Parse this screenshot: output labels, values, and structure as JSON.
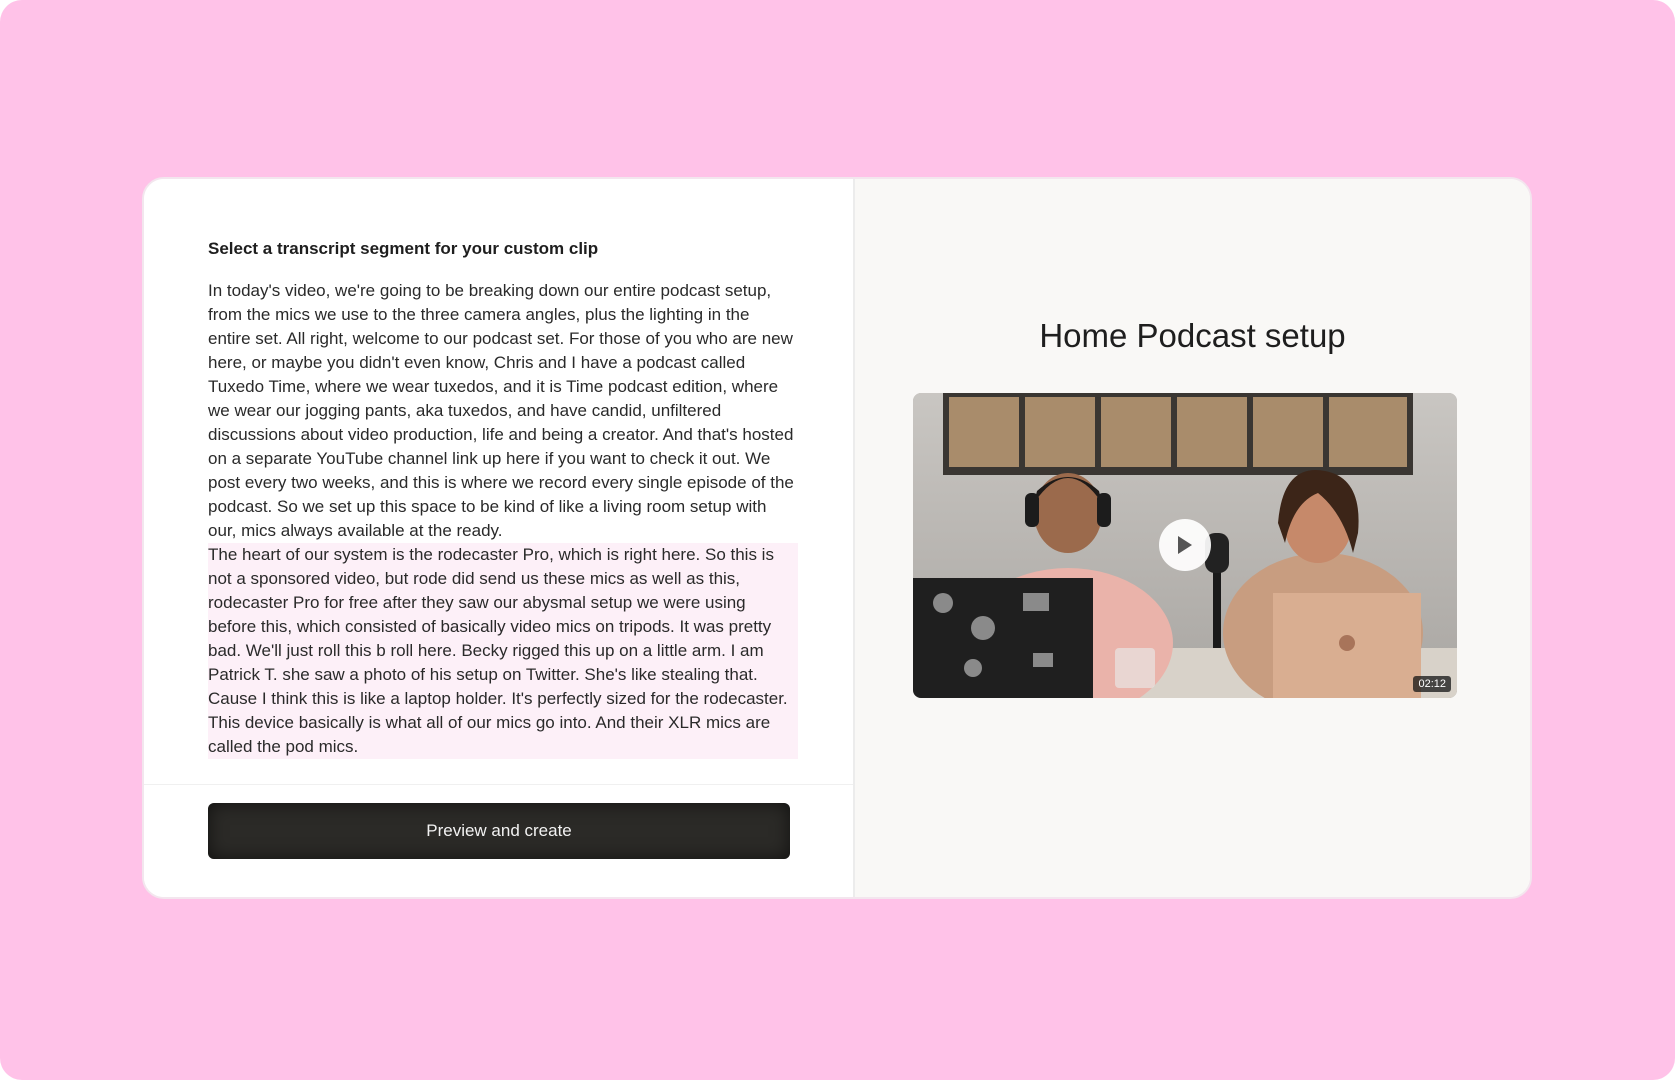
{
  "transcript_panel": {
    "heading": "Select a transcript segment for your custom clip",
    "segments": [
      {
        "text": "In today's video, we're going to be breaking down our entire podcast setup, from the mics we use to the three camera angles, plus the lighting in the entire set. All right, welcome to our podcast set. For those of you who are new here, or maybe you didn't even know, Chris and I have a podcast called Tuxedo Time, where we wear tuxedos, and it is Time podcast edition, where we wear our jogging pants, aka tuxedos, and have candid, unfiltered discussions about video production, life and being a creator. And that's hosted on a separate YouTube channel link up here if you want to check it out. We post every two weeks, and this is where we record every single episode of the podcast. So we set up this space to be kind of like a living room setup with our, mics always available at the ready.",
        "selected": false
      },
      {
        "text": "The heart of our system is the rodecaster Pro, which is right here. So this is not a sponsored video, but rode did send us these mics as well as this, rodecaster Pro for free after they saw our abysmal setup we were using before this, which consisted of basically video mics on tripods. It was pretty bad. We'll just roll this b roll here. Becky rigged this up on a little arm. I am Patrick T. she saw a photo of his setup on Twitter. She's like stealing that. Cause I think this is like a laptop holder. It's perfectly sized for the rodecaster. This device basically is what all of our mics go into. And their XLR mics are called the pod mics.",
        "selected": true
      }
    ],
    "primary_button_label": "Preview and create"
  },
  "video_panel": {
    "title": "Home Podcast setup",
    "duration": "02:12",
    "play_icon": "play-icon"
  },
  "colors": {
    "background": "#ffc2e8",
    "selected_segment": "#fdf0f8",
    "button": "#2b2a27"
  }
}
